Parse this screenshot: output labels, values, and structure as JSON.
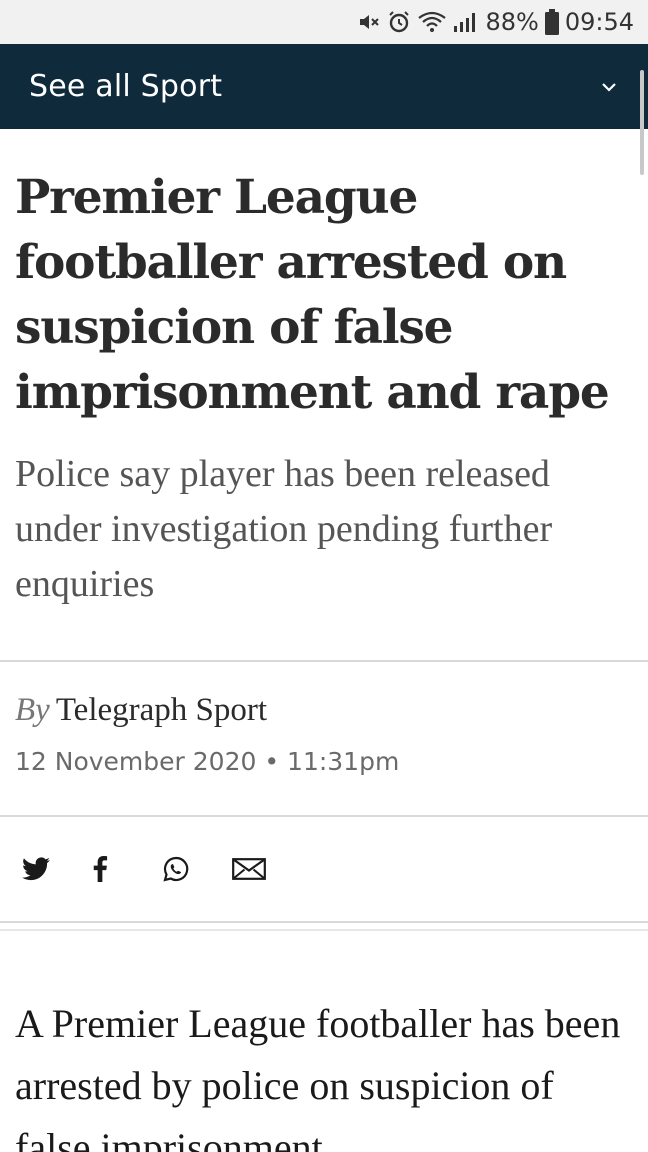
{
  "status_bar": {
    "battery": "88%",
    "time": "09:54",
    "icons": [
      "mute-icon",
      "alarm-icon",
      "wifi-icon",
      "signal-icon",
      "battery-icon"
    ]
  },
  "nav": {
    "label": "See all Sport",
    "chevron_icon": "chevron-down-icon",
    "background": "#0e2a3b"
  },
  "article": {
    "headline": "Premier League footballer arrested on suspicion of false imprisonment and rape",
    "standfirst": "Police say player has been released under investigation pending further enquiries",
    "byline_prefix": "By",
    "author": "Telegraph Sport",
    "date": "12 November 2020",
    "time": "11:31pm",
    "body_first_paragraph": "A Premier League footballer has been arrested by police on suspicion of false imprisonment"
  },
  "share": {
    "buttons": [
      "twitter-icon",
      "facebook-icon",
      "whatsapp-icon",
      "email-icon"
    ]
  }
}
